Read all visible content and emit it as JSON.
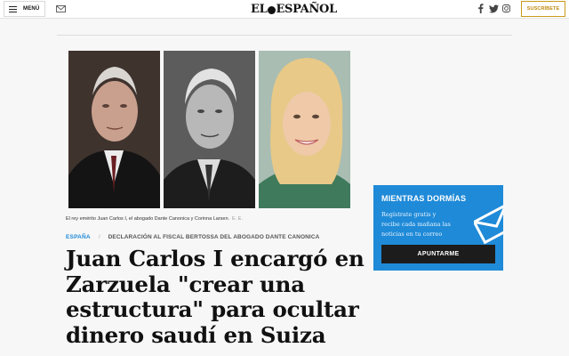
{
  "header": {
    "menu_label": "MENÚ",
    "logo_left": "EL",
    "logo_right": "ESPAÑOL",
    "subscribe_label": "SUSCRÍBETE"
  },
  "icons": {
    "menu": "hamburger-icon",
    "mail": "mail-icon",
    "facebook": "facebook-icon",
    "twitter": "twitter-icon",
    "instagram": "instagram-icon",
    "newsletter": "envelope-icon"
  },
  "photo_caption": {
    "text": "El rey emérito Juan Carlos I, el abogado Dante Canonica y Corinna Larsen.",
    "credit": "E. E."
  },
  "article": {
    "section": "ESPAÑA",
    "separator": "/",
    "topic": "DECLARACIÓN AL FISCAL BERTOSSA DEL ABOGADO DANTE CANONICA",
    "headline_lines": [
      "Juan Carlos I encargó en",
      "Zarzuela \"crear una",
      "estructura\" para ocultar",
      "dinero saudí en Suiza"
    ]
  },
  "newsletter": {
    "title": "MIENTRAS DORMÍAS",
    "text_lines": [
      "Regístrate gratis y",
      "recibe cada mañana las",
      "noticias en tu correo"
    ],
    "button_label": "APUNTARME"
  },
  "colors": {
    "accent_blue": "#1f8ad8",
    "subscribe_gold": "#c18b12",
    "button_dark": "#1c1c1c"
  }
}
